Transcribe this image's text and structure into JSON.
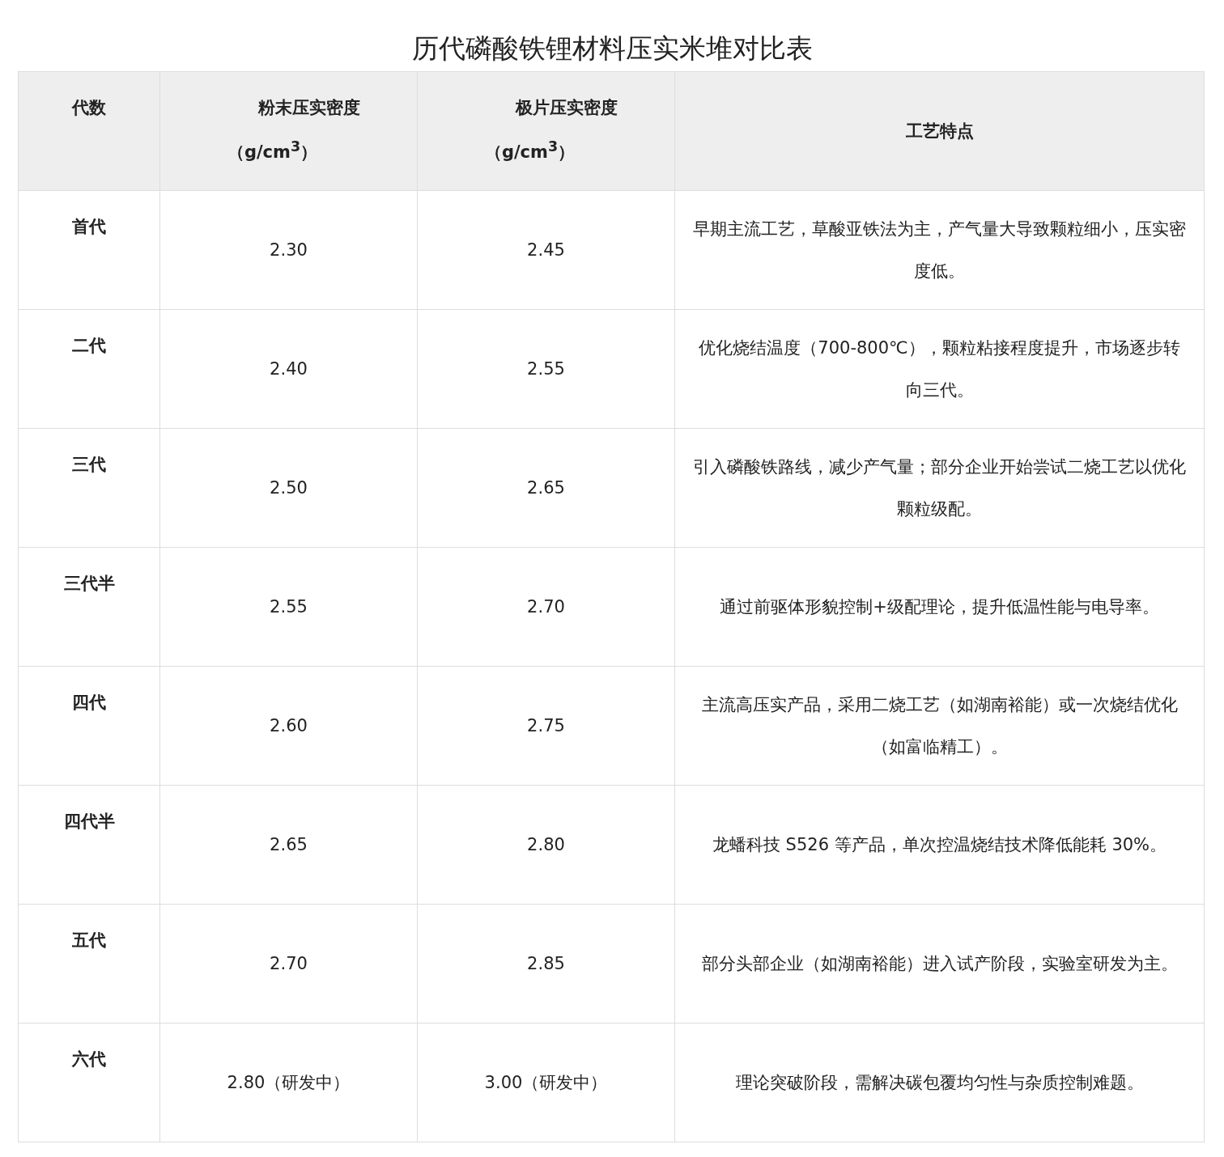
{
  "title": "历代磷酸铁锂材料压实米堆对比表",
  "table": {
    "columns": [
      {
        "label": "代数"
      },
      {
        "label": "粉末压实密度",
        "unit": "（g/cm$^{3}$）"
      },
      {
        "label": "极片压实密度",
        "unit": "（g/cm$^{3}$）"
      },
      {
        "label": "工艺特点"
      }
    ],
    "rows": [
      {
        "generation": "首代",
        "powder_density": "2.30",
        "electrode_density": "2.45",
        "process": "早期主流工艺，草酸亚铁法为主，产气量大导致颗粒细小，压实密度低。"
      },
      {
        "generation": "二代",
        "powder_density": "2.40",
        "electrode_density": "2.55",
        "process": "优化烧结温度（700-800℃），颗粒粘接程度提升，市场逐步转向三代。"
      },
      {
        "generation": "三代",
        "powder_density": "2.50",
        "electrode_density": "2.65",
        "process": "引入磷酸铁路线，减少产气量；部分企业开始尝试二烧工艺以优化颗粒级配。"
      },
      {
        "generation": "三代半",
        "powder_density": "2.55",
        "electrode_density": "2.70",
        "process": "通过前驱体形貌控制+级配理论，提升低温性能与电导率。"
      },
      {
        "generation": "四代",
        "powder_density": "2.60",
        "electrode_density": "2.75",
        "process": "主流高压实产品，采用二烧工艺（如湖南裕能）或一次烧结优化（如富临精工）。"
      },
      {
        "generation": "四代半",
        "powder_density": "2.65",
        "electrode_density": "2.80",
        "process": "龙蟠科技 S526 等产品，单次控温烧结技术降低能耗 30%。"
      },
      {
        "generation": "五代",
        "powder_density": "2.70",
        "electrode_density": "2.85",
        "process": "部分头部企业（如湖南裕能）进入试产阶段，实验室研发为主。"
      },
      {
        "generation": "六代",
        "powder_density": "2.80（研发中）",
        "electrode_density": "3.00（研发中）",
        "process": "理论突破阶段，需解决碳包覆均匀性与杂质控制难题。"
      }
    ]
  }
}
